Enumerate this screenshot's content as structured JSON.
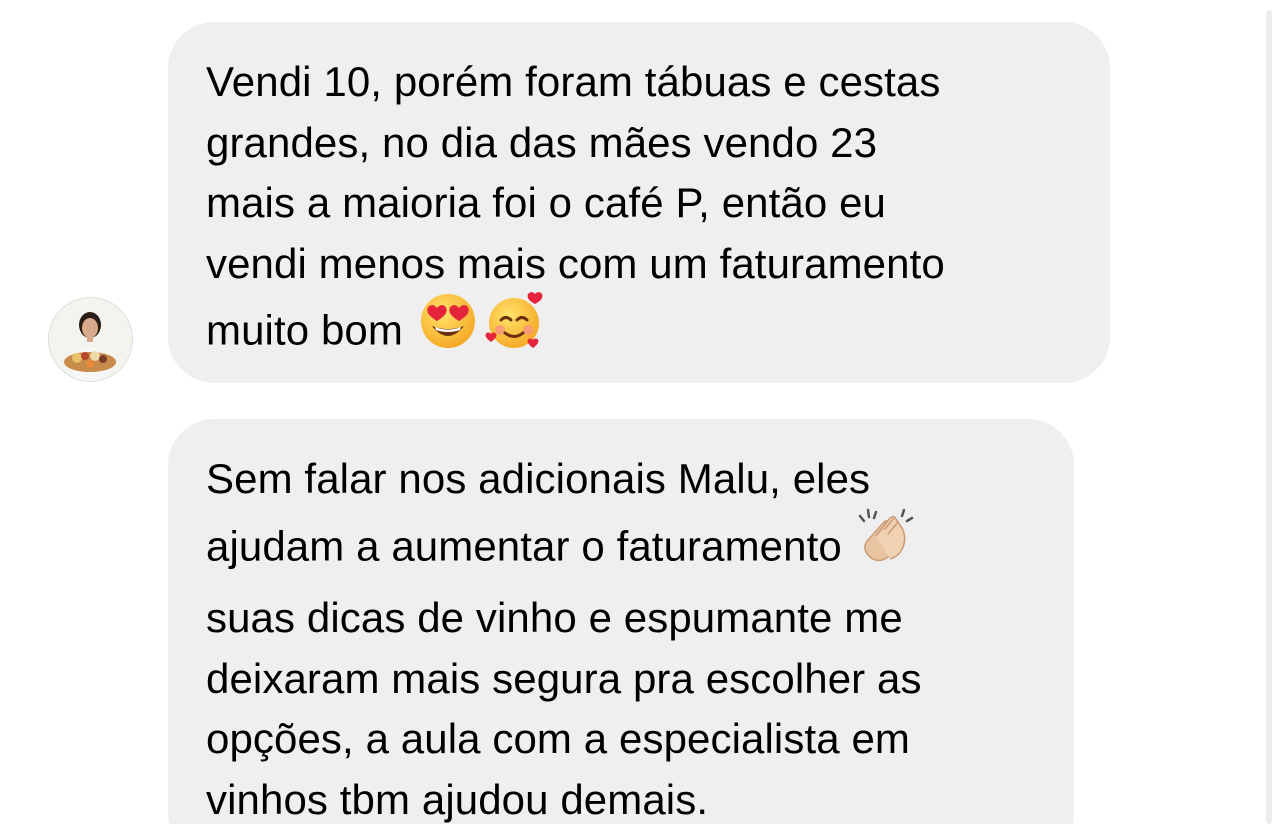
{
  "messages": [
    {
      "lines": [
        "Vendi 10, porém foram tábuas e cestas",
        "grandes, no dia das mães vendo 23",
        "mais a maioria foi o café P, então eu",
        "vendi menos mais com um faturamento",
        "muito bom"
      ],
      "emojis": [
        "heart-eyes-emoji",
        "smiling-face-with-hearts-emoji"
      ]
    },
    {
      "lines": [
        "Sem falar nos adicionais Malu, eles",
        "ajudam a aumentar o faturamento",
        "suas dicas de vinho e espumante me",
        "deixaram mais segura pra escolher as",
        "opções, a aula com a especialista em",
        "vinhos tbm ajudou demais."
      ],
      "emojis": [
        "clapping-hands-emoji"
      ]
    }
  ],
  "colors": {
    "bubble_bg": "#efefef",
    "text": "#000000",
    "background": "#ffffff"
  },
  "icons": {
    "avatar": "sender-avatar"
  }
}
